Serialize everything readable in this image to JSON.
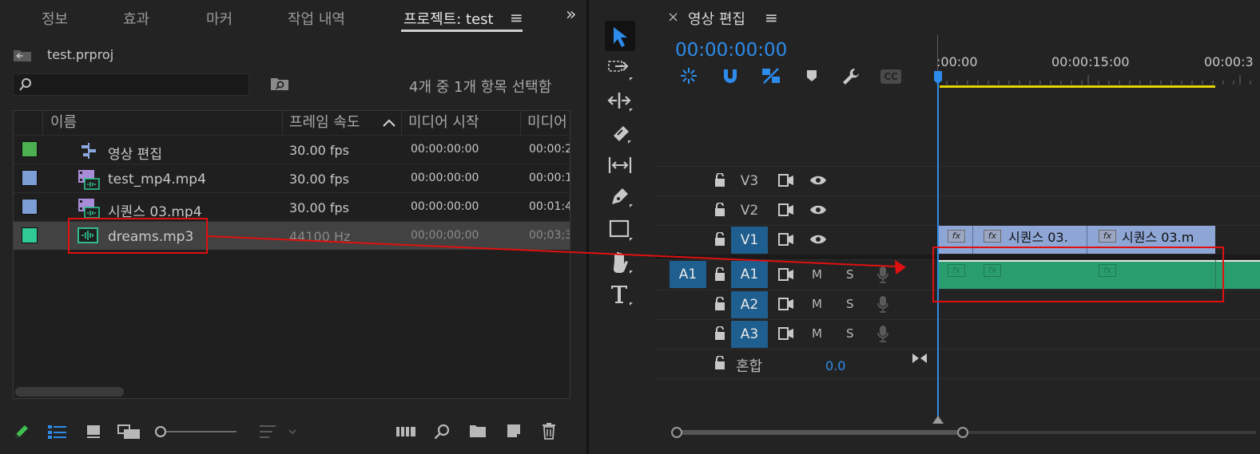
{
  "project_panel": {
    "tabs": [
      "정보",
      "효과",
      "마커",
      "작업 내역",
      "프로젝트: test"
    ],
    "menu_glyph": "≡",
    "expand_glyph": "»",
    "project_file": "test.prproj",
    "search_placeholder": "",
    "selection_status": "4개 중 1개 항목 선택함",
    "columns": [
      "이름",
      "프레임 속도",
      "미디어 시작",
      "미디어"
    ],
    "sort_glyph": "^",
    "items": [
      {
        "name": "영상 편집",
        "rate": "30.00 fps",
        "start": "00:00:00:00",
        "more": "00:00:2",
        "color": "#4caf50",
        "icon": "sequence-icon"
      },
      {
        "name": "test_mp4.mp4",
        "rate": "30.00 fps",
        "start": "00:00:00:00",
        "more": "00:00:1",
        "color": "#7d9ed4",
        "icon": "video-clip-icon"
      },
      {
        "name": "시퀀스 03.mp4",
        "rate": "30.00 fps",
        "start": "00:00:00:00",
        "more": "00:01:4",
        "color": "#7d9ed4",
        "icon": "video-clip-icon"
      },
      {
        "name": "dreams.mp3",
        "rate": "44100 Hz",
        "start": "00;00;00;00",
        "more": "00;03;3",
        "color": "#2ecc94",
        "icon": "audio-clip-icon"
      }
    ]
  },
  "timeline": {
    "close_glyph": "×",
    "title": "영상 편집",
    "menu_glyph": "≡",
    "timecode": "00:00:00:00",
    "ruler_labels": [
      ":00:00",
      "00:00:15:00",
      "00:00:3"
    ],
    "cc_label": "CC",
    "video_tracks": [
      "V3",
      "V2",
      "V1"
    ],
    "audio_tracks": [
      "A1",
      "A2",
      "A3"
    ],
    "source_patch": "A1",
    "mute_label": "M",
    "solo_label": "S",
    "mix_label": "혼합",
    "mix_value": "0.0",
    "fx_label": "fx",
    "clips": [
      "시퀀스 03.",
      "시퀀스 03.m"
    ]
  },
  "colors": {
    "accent": "#2d8ceb",
    "selected_track": "#1f5f8f",
    "video_clip": "#8ea6d6",
    "audio_clip": "#2a9d6e",
    "annotation": "#e01010",
    "work_area": "#e5d400"
  }
}
